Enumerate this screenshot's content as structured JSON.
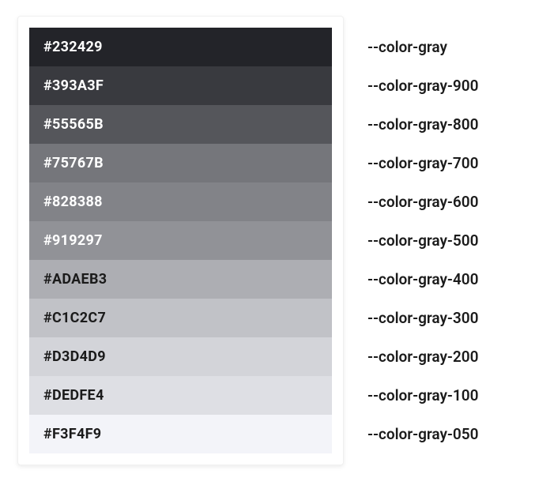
{
  "swatches": [
    {
      "hex": "#232429",
      "var": "--color-gray",
      "text": "#ffffff"
    },
    {
      "hex": "#393A3F",
      "var": "--color-gray-900",
      "text": "#ffffff"
    },
    {
      "hex": "#55565B",
      "var": "--color-gray-800",
      "text": "#ffffff"
    },
    {
      "hex": "#75767B",
      "var": "--color-gray-700",
      "text": "#ffffff"
    },
    {
      "hex": "#828388",
      "var": "--color-gray-600",
      "text": "#ffffff"
    },
    {
      "hex": "#919297",
      "var": "--color-gray-500",
      "text": "#ffffff"
    },
    {
      "hex": "#ADAEB3",
      "var": "--color-gray-400",
      "text": "#1b1b1b"
    },
    {
      "hex": "#C1C2C7",
      "var": "--color-gray-300",
      "text": "#1b1b1b"
    },
    {
      "hex": "#D3D4D9",
      "var": "--color-gray-200",
      "text": "#1b1b1b"
    },
    {
      "hex": "#DEDFE4",
      "var": "--color-gray-100",
      "text": "#1b1b1b"
    },
    {
      "hex": "#F3F4F9",
      "var": "--color-gray-050",
      "text": "#1b1b1b"
    }
  ]
}
